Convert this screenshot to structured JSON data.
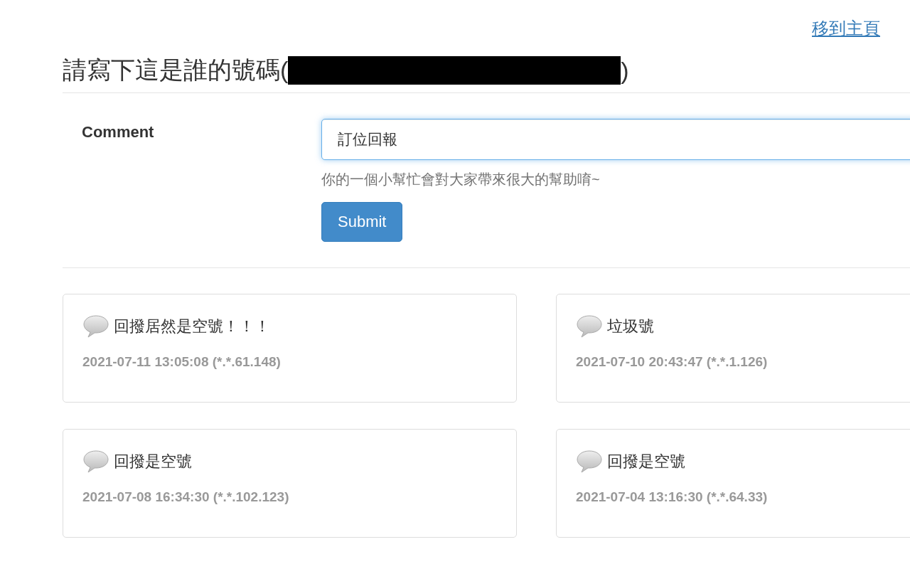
{
  "home_link": "移到主頁",
  "title": {
    "before": "請寫下這是誰的號碼(",
    "after": ")",
    "redacted": true
  },
  "form": {
    "label": "Comment",
    "value": "訂位回報",
    "focused": true,
    "help": "你的一個小幫忙會對大家帶來很大的幫助唷~",
    "submit": "Submit"
  },
  "comments": [
    {
      "text": "回撥居然是空號！！！",
      "meta": "2021-07-11 13:05:08 (*.*.61.148)"
    },
    {
      "text": "垃圾號",
      "meta": "2021-07-10 20:43:47 (*.*.1.126)"
    },
    {
      "text": "回撥是空號",
      "meta": "2021-07-08 16:34:30 (*.*.102.123)"
    },
    {
      "text": "回撥是空號",
      "meta": "2021-07-04 13:16:30 (*.*.64.33)"
    }
  ]
}
